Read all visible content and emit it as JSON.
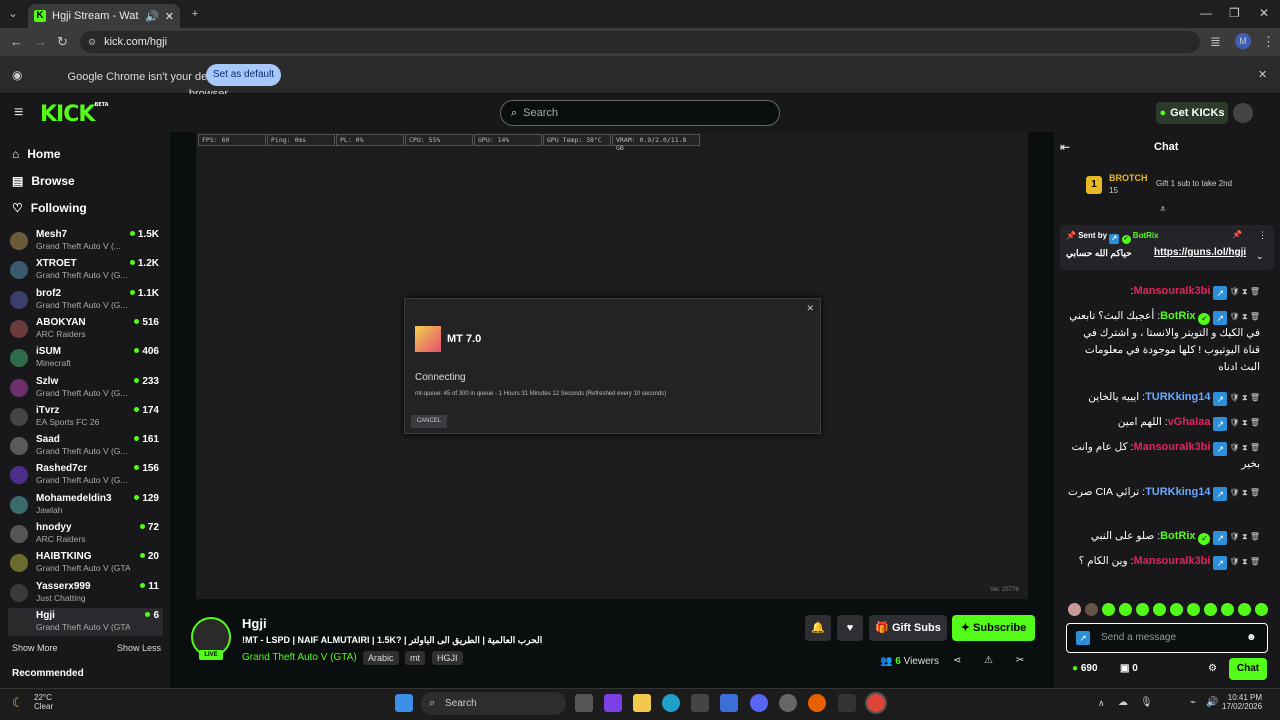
{
  "browser": {
    "tab_title": "Hgji Stream - Watch Live o",
    "url": "kick.com/hgji",
    "profile_initial": "M",
    "infobar_message": "Google Chrome isn't your default browser",
    "set_default_label": "Set as default"
  },
  "header": {
    "logo": "KICK",
    "logo_sup": "BETA",
    "search_placeholder": "Search",
    "get_kicks_label": "Get KICKs"
  },
  "sidebar": {
    "nav": [
      {
        "label": "Home"
      },
      {
        "label": "Browse"
      },
      {
        "label": "Following"
      }
    ],
    "channels": [
      {
        "name": "Mesh7",
        "game": "Grand Theft Auto V (...",
        "viewers": "1.5K"
      },
      {
        "name": "XTROET",
        "game": "Grand Theft Auto V (G...",
        "viewers": "1.2K"
      },
      {
        "name": "brof2",
        "game": "Grand Theft Auto V (G...",
        "viewers": "1.1K"
      },
      {
        "name": "ABOKYAN",
        "game": "ARC Raiders",
        "viewers": "516"
      },
      {
        "name": "iSUM",
        "game": "Minecraft",
        "viewers": "406"
      },
      {
        "name": "Szlw",
        "game": "Grand Theft Auto V (G...",
        "viewers": "233"
      },
      {
        "name": "iTvrz",
        "game": "EA Sports FC 26",
        "viewers": "174"
      },
      {
        "name": "Saad",
        "game": "Grand Theft Auto V (G...",
        "viewers": "161"
      },
      {
        "name": "Rashed7cr",
        "game": "Grand Theft Auto V (G...",
        "viewers": "156"
      },
      {
        "name": "Mohamedeldin3",
        "game": "Jawlah",
        "viewers": "129"
      },
      {
        "name": "hnodyy",
        "game": "ARC Raiders",
        "viewers": "72"
      },
      {
        "name": "HAIBTKING",
        "game": "Grand Theft Auto V (GTA)",
        "viewers": "20"
      },
      {
        "name": "Yasserx999",
        "game": "Just Chatting",
        "viewers": "11"
      },
      {
        "name": "Hgji",
        "game": "Grand Theft Auto V (GTA)",
        "viewers": "6"
      }
    ],
    "show_more": "Show More",
    "show_less": "Show Less",
    "recommended": "Recommended"
  },
  "player": {
    "stats": [
      "FPS: 60",
      "Ping: 0ms",
      "PL: 0%",
      "CPU: 55%",
      "GPU: 14%",
      "GPU Temp: 38°C",
      "VRAM: 0.9/2.0/11.8 GB"
    ],
    "modal_title": "MT 7.0",
    "modal_status": "Connecting",
    "modal_queue": "mt-queue: 45 of 300 in queue - 1 Hours 31 Minutes 12 Seconds (Refreshed every 10 seconds)",
    "modal_cancel": "CANCEL",
    "version": "Ver. 25776"
  },
  "stream": {
    "name": "Hgji",
    "live_badge": "LIVE",
    "title": "!MT  - LSPD | NAIF ALMUTAIRI | 1.5K? | الحرب العالمية | الطريق الى الباولتر",
    "game": "Grand Theft Auto V (GTA)",
    "tags": [
      "Arabic",
      "mt",
      "HGJI"
    ],
    "gift_subs_label": "Gift Subs",
    "subscribe_label": "Subscribe",
    "viewers_count": "6",
    "viewers_label": "Viewers"
  },
  "chat": {
    "title": "Chat",
    "leader_rank": "1",
    "leader_name": "BROTCH",
    "leader_count": "15",
    "gift_text": "Gift 1 sub to take 2nd",
    "pinned_sent_by": "Sent by",
    "pinned_user": "BotRix",
    "pinned_text": "حياكم الله حسابي",
    "pinned_link": "https://guns.lol/hgji",
    "messages": [
      {
        "user": "Mansouralk3bi",
        "color": "#e0245e",
        "text": ""
      },
      {
        "user": "BotRix",
        "color": "#53fc18",
        "text": "أعجبك البث؟ تابعني في الكيك و التويتر والانستا ، و اشترك في قناة اليوتيوب ! كلها موجودة في معلومات البث ادناه"
      },
      {
        "user": "TURKking14",
        "color": "#6aa8ff",
        "text": "ايييه يالخاين"
      },
      {
        "user": "vGhalaa",
        "color": "#e0245e",
        "text": "اللهم امين"
      },
      {
        "user": "Mansouralk3bi",
        "color": "#e0245e",
        "text": "كل عام وانت بخير"
      },
      {
        "user": "TURKking14",
        "color": "#6aa8ff",
        "text": "ترائي CIA صرت"
      },
      {
        "user": "BotRix",
        "color": "#53fc18",
        "text": "صلو على النبي"
      },
      {
        "user": "Mansouralk3bi",
        "color": "#e0245e",
        "text": "وين الكام ؟"
      }
    ],
    "input_placeholder": "Send a message",
    "kicks_count": "690",
    "gifts_count": "0",
    "chat_button": "Chat"
  },
  "taskbar": {
    "weather_temp": "22°C",
    "weather_desc": "Clear",
    "search_label": "Search",
    "time": "10:41 PM",
    "date": "17/02/2026"
  }
}
